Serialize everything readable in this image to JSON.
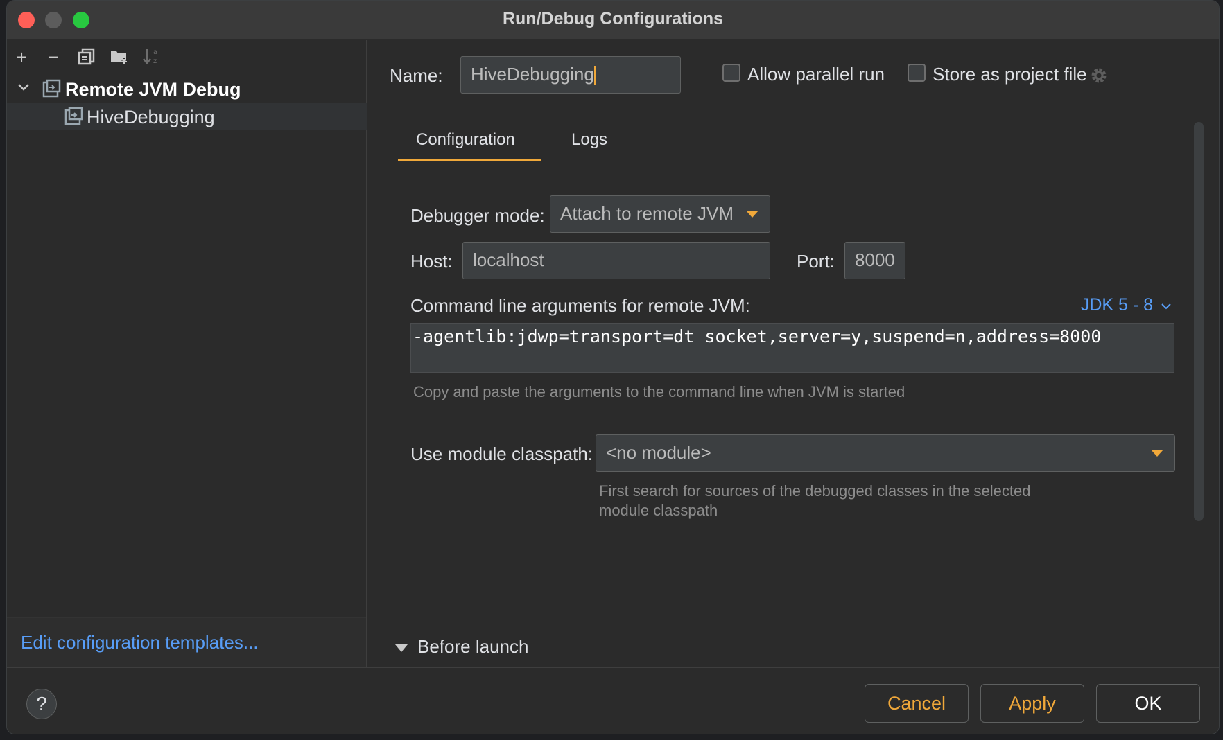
{
  "window": {
    "title": "Run/Debug Configurations"
  },
  "toolbar": {
    "add": "+",
    "remove": "−"
  },
  "tree": {
    "group_label": "Remote JVM Debug",
    "child_label": "HiveDebugging"
  },
  "left_footer": {
    "link": "Edit configuration templates..."
  },
  "name_row": {
    "label": "Name:",
    "value": "HiveDebugging",
    "allow_parallel": "Allow parallel run",
    "store_project": "Store as project file"
  },
  "tabs": [
    "Configuration",
    "Logs"
  ],
  "debugger": {
    "mode_label": "Debugger mode:",
    "mode_value": "Attach to remote JVM",
    "host_label": "Host:",
    "host_value": "localhost",
    "port_label": "Port:",
    "port_value": "8000"
  },
  "cmdline": {
    "label": "Command line arguments for remote JVM:",
    "jdk": "JDK 5 - 8",
    "value": "-agentlib:jdwp=transport=dt_socket,server=y,suspend=n,address=8000",
    "hint": "Copy and paste the arguments to the command line when JVM is started"
  },
  "module": {
    "label": "Use module classpath:",
    "value": "<no module>",
    "hint_line1": "First search for sources of the debugged classes in the selected",
    "hint_line2": "module classpath"
  },
  "before_launch": {
    "label": "Before launch"
  },
  "buttons": {
    "help": "?",
    "cancel": "Cancel",
    "apply": "Apply",
    "ok": "OK"
  },
  "colors": {
    "accent": "#f0a83a",
    "link": "#589df6",
    "background": "#2b2b2b"
  }
}
